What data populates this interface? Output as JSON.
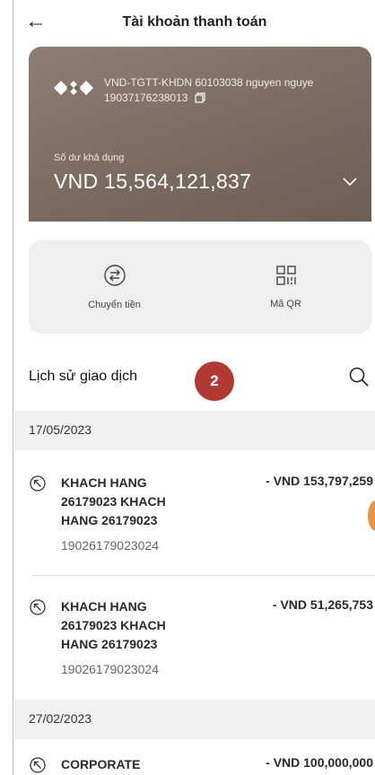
{
  "header": {
    "back_icon": "arrow-left-icon",
    "title": "Tài khoản thanh toán"
  },
  "account_card": {
    "account_name": "VND-TGTT-KHDN 60103038 nguyen nguye",
    "account_number": "19037176238013",
    "balance_label": "Số dư khả dụng",
    "balance": "VND 15,564,121,837"
  },
  "actions": [
    {
      "label": "Chuyển tiền",
      "icon": "transfer-icon"
    },
    {
      "label": "Mã QR",
      "icon": "qr-icon"
    }
  ],
  "history": {
    "title": "Lịch sử giao dịch",
    "badge": "2"
  },
  "groups": [
    {
      "date": "17/05/2023",
      "transactions": [
        {
          "name": "KHACH HANG 26179023 KHACH HANG 26179023",
          "account": "19026179023024",
          "amount": "- VND 153,797,259"
        },
        {
          "name": "KHACH HANG 26179023 KHACH HANG 26179023",
          "account": "19026179023024",
          "amount": "- VND 51,265,753"
        }
      ]
    },
    {
      "date": "27/02/2023",
      "transactions": [
        {
          "name": "CORPORATE",
          "account": "",
          "amount": "- VND 100,000,000"
        }
      ]
    }
  ],
  "colors": {
    "card": "#7a6a60",
    "badge": "#b13a34",
    "accent_peek": "#e8944a"
  }
}
